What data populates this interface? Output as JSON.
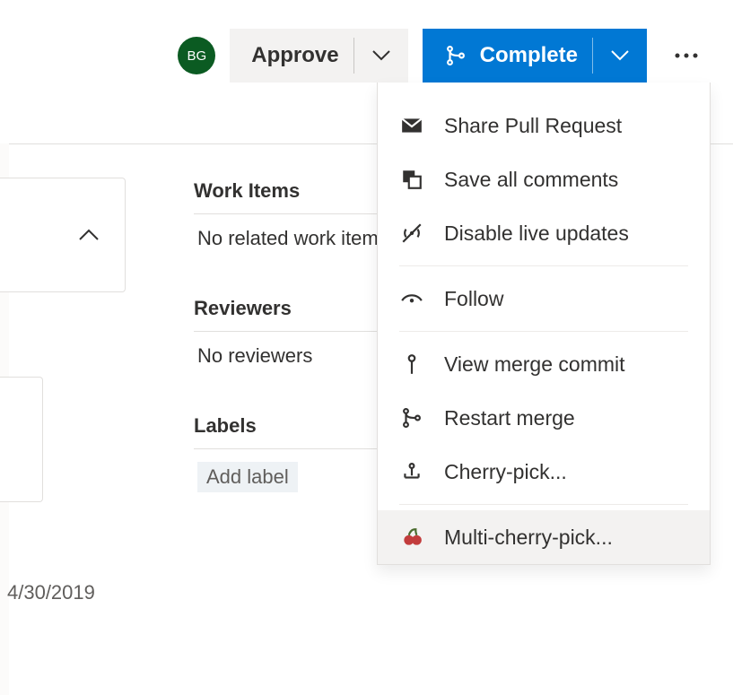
{
  "avatar": {
    "initials": "BG"
  },
  "toolbar": {
    "approve_label": "Approve",
    "complete_label": "Complete"
  },
  "date": "4/30/2019",
  "sidebar": {
    "work_items": {
      "title": "Work Items",
      "body": "No related work items"
    },
    "reviewers": {
      "title": "Reviewers",
      "body": "No reviewers"
    },
    "labels": {
      "title": "Labels",
      "placeholder": "Add label"
    }
  },
  "menu": [
    {
      "icon": "mail-icon",
      "label": "Share Pull Request"
    },
    {
      "icon": "save-icon",
      "label": "Save all comments"
    },
    {
      "icon": "live-off-icon",
      "label": "Disable live updates"
    },
    {
      "sep": true
    },
    {
      "icon": "eye-icon",
      "label": "Follow"
    },
    {
      "sep": true
    },
    {
      "icon": "commit-icon",
      "label": "View merge commit"
    },
    {
      "icon": "merge-icon",
      "label": "Restart merge"
    },
    {
      "icon": "cherry-pick-icon",
      "label": "Cherry-pick..."
    },
    {
      "sep": true
    },
    {
      "icon": "multi-cherry-icon",
      "label": "Multi-cherry-pick...",
      "highlight": true
    }
  ]
}
